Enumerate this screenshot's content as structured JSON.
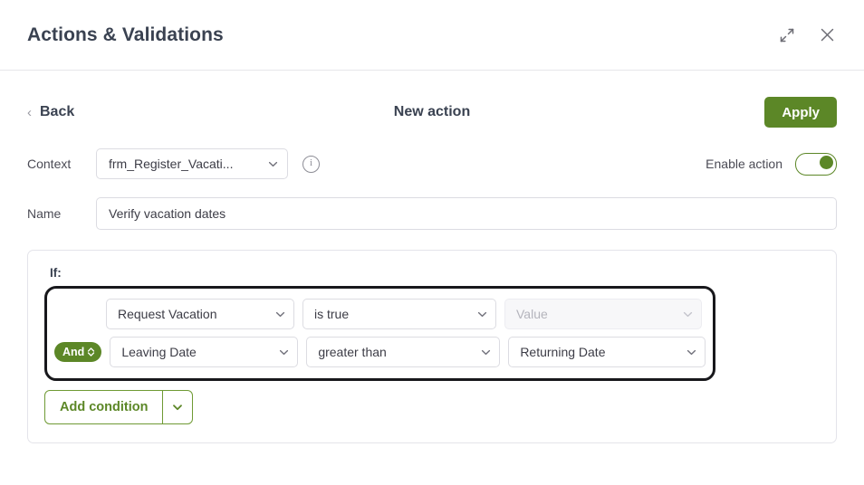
{
  "header": {
    "title": "Actions & Validations",
    "expand_icon": "expand-diagonal-icon",
    "close_icon": "close-icon"
  },
  "action_bar": {
    "back_label": "Back",
    "back_icon": "chevron-left-icon",
    "center_title": "New action",
    "apply_label": "Apply",
    "apply_color": "#5c8727"
  },
  "context": {
    "label": "Context",
    "value": "frm_Register_Vacati...",
    "chevron_icon": "chevron-down-icon",
    "info_icon": "info-circle-icon",
    "info_glyph": "i"
  },
  "enable": {
    "label": "Enable action",
    "state": "on",
    "accent": "#5c8727"
  },
  "name": {
    "label": "Name",
    "value": "Verify vacation dates",
    "placeholder": "Name"
  },
  "conditions": {
    "if_label": "If:",
    "highlight_color": "#18181c",
    "rows": [
      {
        "connector": null,
        "field": {
          "value": "Request Vacation",
          "disabled": false
        },
        "operator": {
          "value": "is true",
          "disabled": false
        },
        "value": {
          "value": "Value",
          "disabled": true
        }
      },
      {
        "connector": {
          "label": "And",
          "icon": "up-down-chevron-icon"
        },
        "field": {
          "value": "Leaving Date",
          "disabled": false
        },
        "operator": {
          "value": "greater than",
          "disabled": false
        },
        "value": {
          "value": "Returning Date",
          "disabled": false
        }
      }
    ],
    "add_button": {
      "label": "Add condition",
      "chevron_icon": "chevron-down-icon",
      "color": "#5c8727"
    }
  }
}
